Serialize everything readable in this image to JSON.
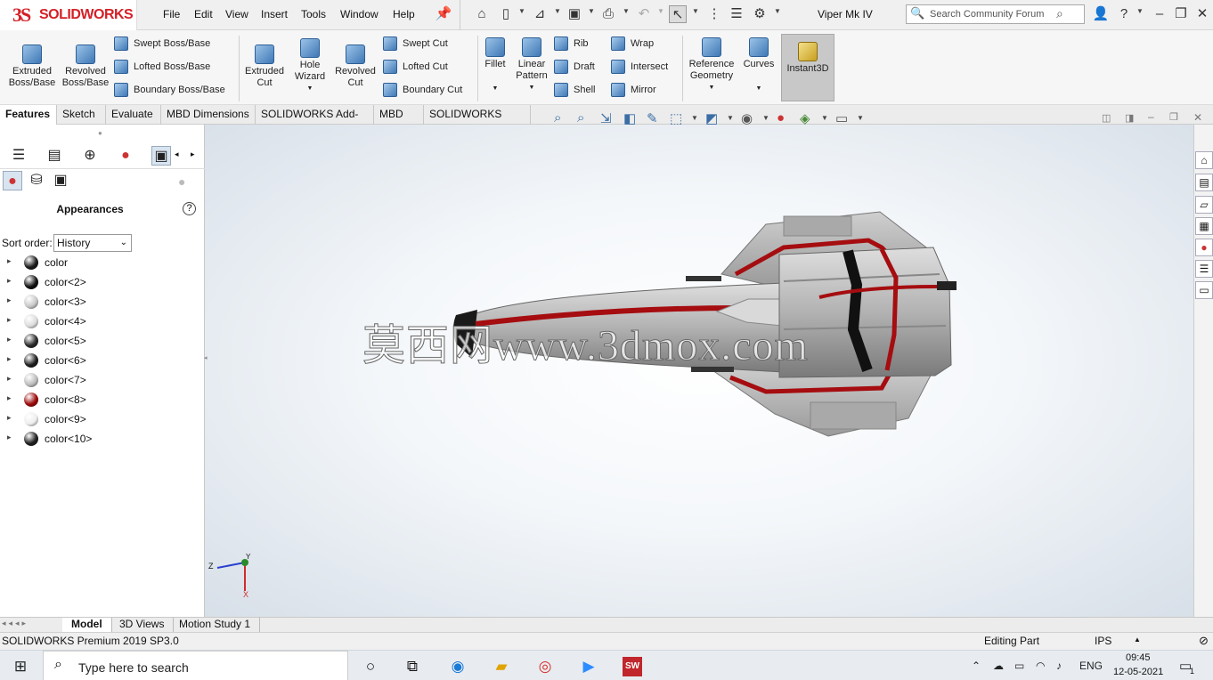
{
  "app": {
    "logo_ds": "3S",
    "logo_text": "SOLIDWORKS",
    "doc_title": "Viper Mk IV",
    "brand_color": "#d42027"
  },
  "menu": [
    "File",
    "Edit",
    "View",
    "Insert",
    "Tools",
    "Window",
    "Help"
  ],
  "search": {
    "placeholder": "Search Community Forum"
  },
  "ribbon": {
    "extruded_boss": "Extruded Boss/Base",
    "revolved_boss": "Revolved Boss/Base",
    "swept_boss": "Swept Boss/Base",
    "lofted_boss": "Lofted Boss/Base",
    "boundary_boss": "Boundary Boss/Base",
    "extruded_cut": "Extruded Cut",
    "hole_wizard": "Hole Wizard",
    "revolved_cut": "Revolved Cut",
    "swept_cut": "Swept Cut",
    "lofted_cut": "Lofted Cut",
    "boundary_cut": "Boundary Cut",
    "fillet": "Fillet",
    "linear_pattern": "Linear Pattern",
    "rib": "Rib",
    "draft": "Draft",
    "shell": "Shell",
    "wrap": "Wrap",
    "intersect": "Intersect",
    "mirror": "Mirror",
    "reference_geometry": "Reference Geometry",
    "curves": "Curves",
    "instant3d": "Instant3D"
  },
  "tabs": [
    "Features",
    "Sketch",
    "Evaluate",
    "MBD Dimensions",
    "SOLIDWORKS Add-Ins",
    "MBD",
    "SOLIDWORKS CAM"
  ],
  "panel": {
    "title": "Appearances",
    "help": "?",
    "sort_label": "Sort order:",
    "sort_value": "History",
    "items": [
      {
        "label": "color",
        "color": "#1a1a1a"
      },
      {
        "label": "color<2>",
        "color": "#111111"
      },
      {
        "label": "color<3>",
        "color": "#c8c8c8"
      },
      {
        "label": "color<4>",
        "color": "#dcdcdc"
      },
      {
        "label": "color<5>",
        "color": "#2a2a2a"
      },
      {
        "label": "color<6>",
        "color": "#1e1e1e"
      },
      {
        "label": "color<7>",
        "color": "#bdbdbd"
      },
      {
        "label": "color<8>",
        "color": "#9c0a0a"
      },
      {
        "label": "color<9>",
        "color": "#eeeeee"
      },
      {
        "label": "color<10>",
        "color": "#202020"
      }
    ]
  },
  "viewport": {
    "watermark": "莫西网www.3dmox.com",
    "triad_x": "X",
    "triad_y": "Y",
    "triad_z": "Z"
  },
  "bottom_tabs": [
    "Model",
    "3D Views",
    "Motion Study 1"
  ],
  "status": {
    "product": "SOLIDWORKS Premium 2019 SP3.0",
    "mode": "Editing Part",
    "units": "IPS"
  },
  "taskbar": {
    "search_placeholder": "Type here to search",
    "lang": "ENG",
    "time": "09:45",
    "date": "12-05-2021",
    "notifications": "1"
  }
}
